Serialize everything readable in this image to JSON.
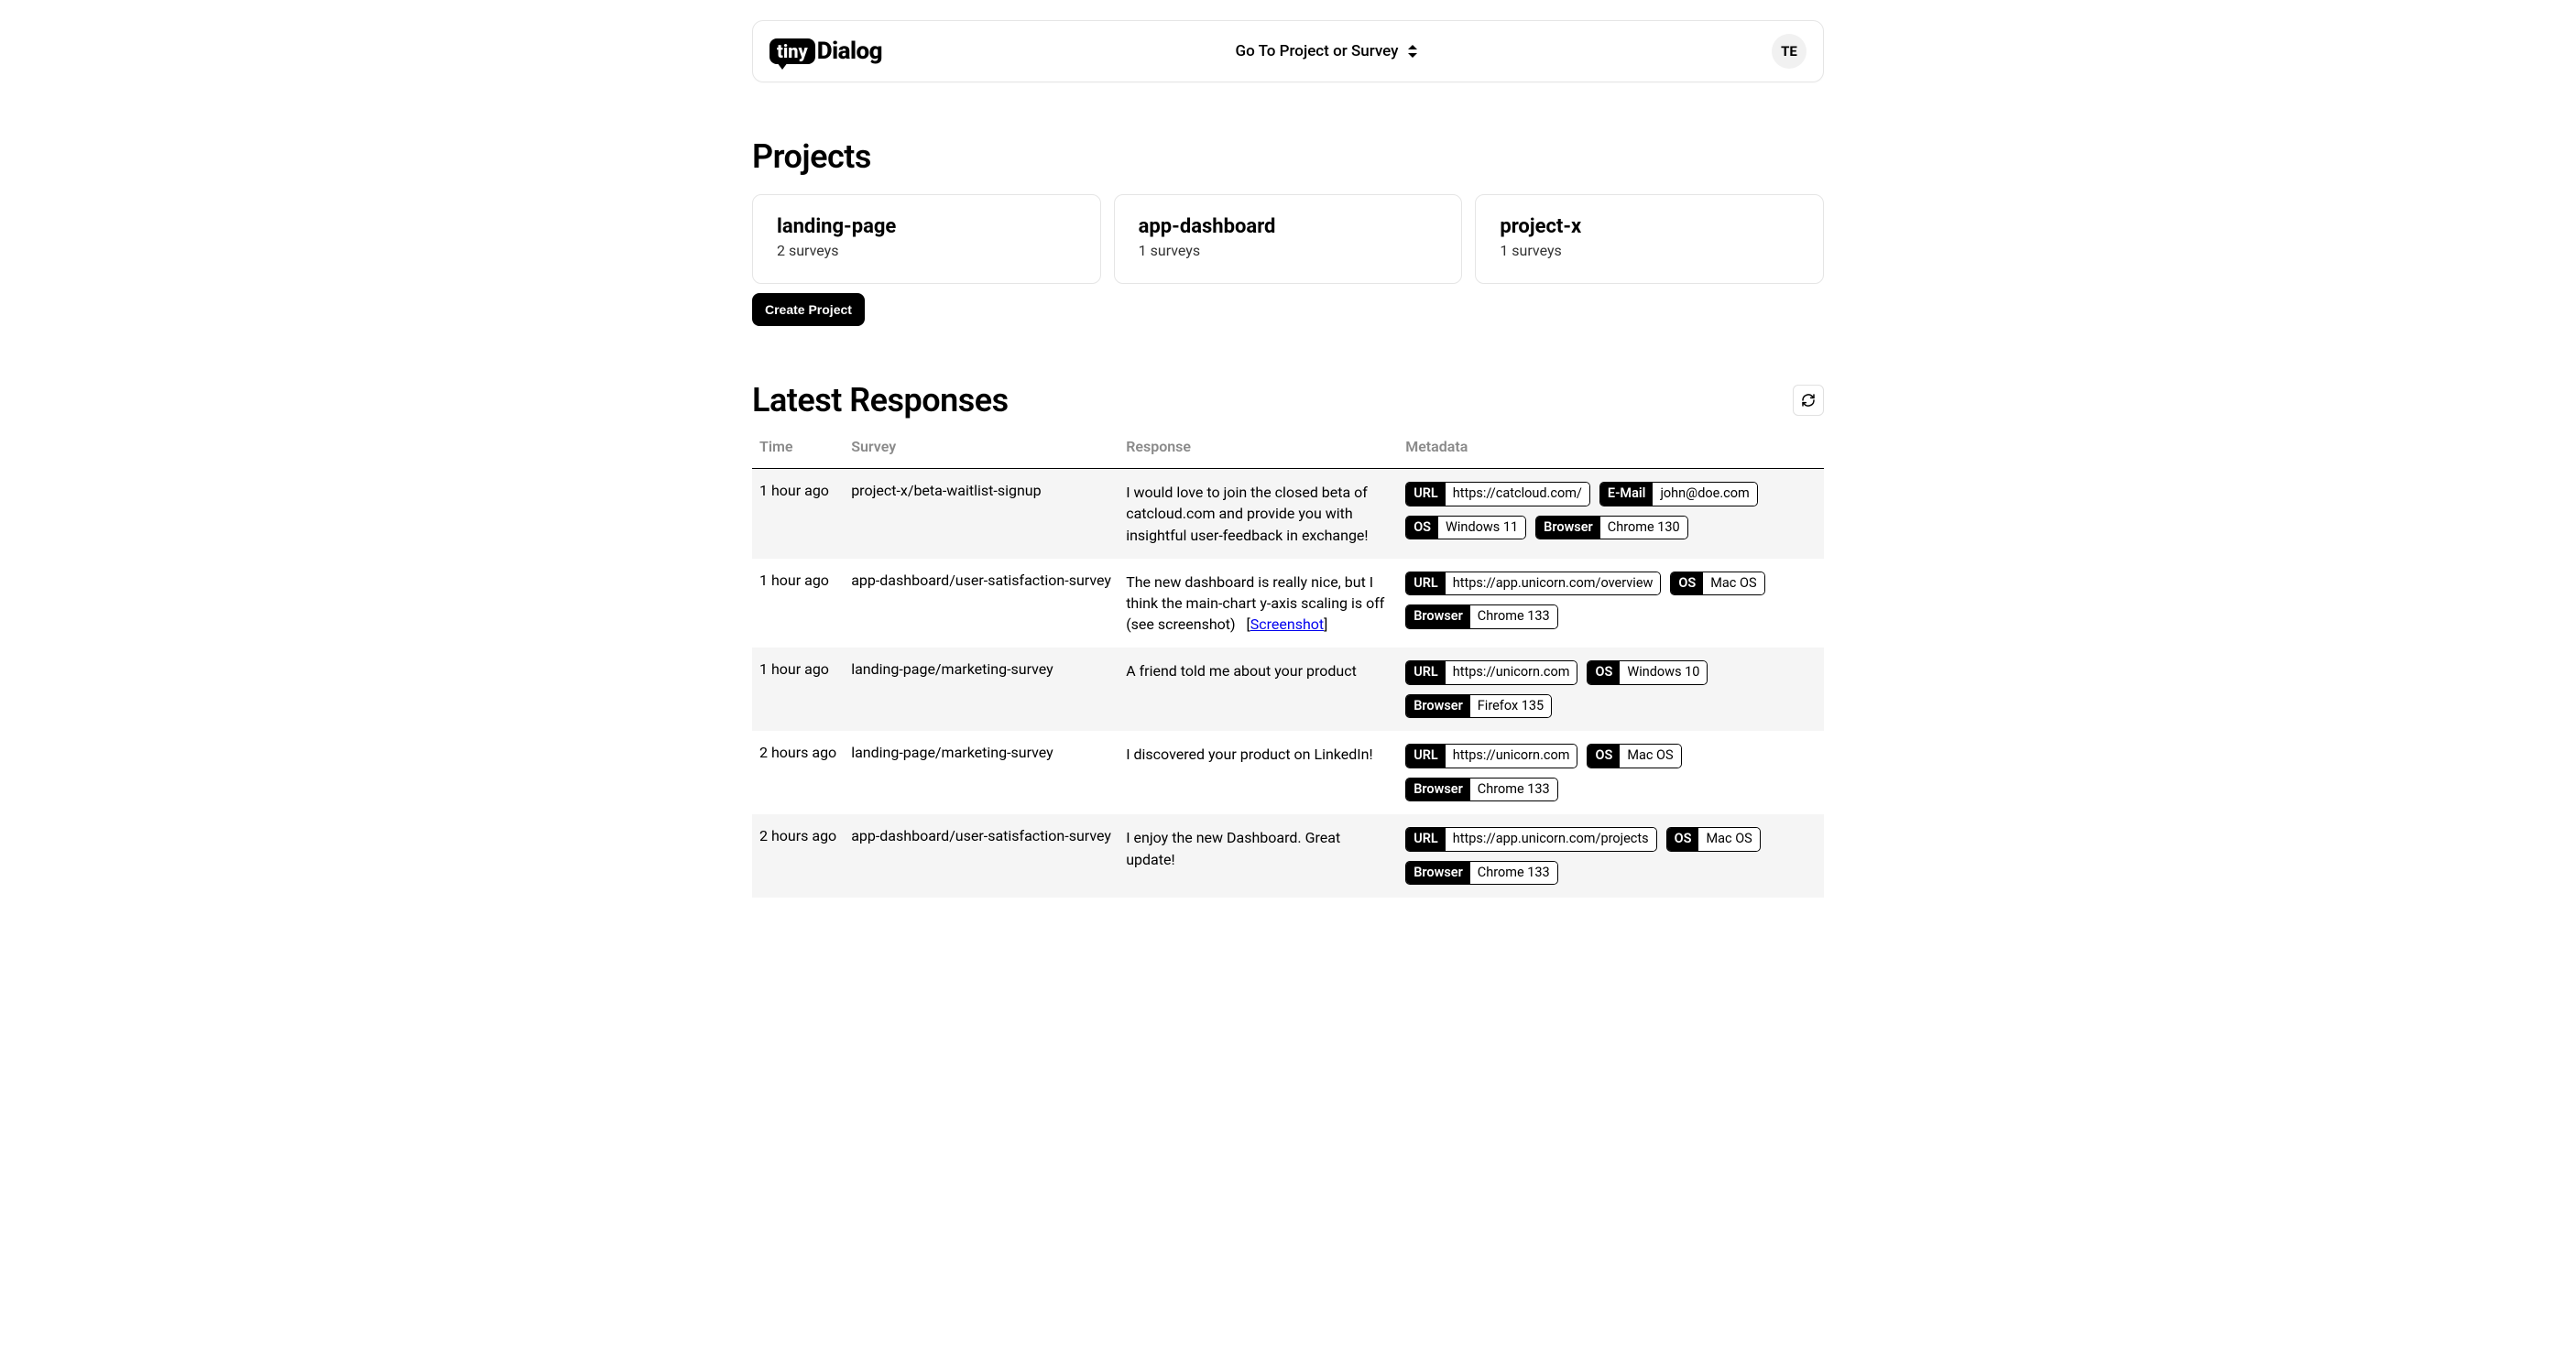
{
  "header": {
    "logo_tiny": "tiny",
    "logo_dialog": "Dialog",
    "nav_label": "Go To Project or Survey",
    "avatar_initials": "TE"
  },
  "projects": {
    "title": "Projects",
    "create_label": "Create Project",
    "items": [
      {
        "name": "landing-page",
        "sub": "2 surveys"
      },
      {
        "name": "app-dashboard",
        "sub": "1 surveys"
      },
      {
        "name": "project-x",
        "sub": "1 surveys"
      }
    ]
  },
  "responses": {
    "title": "Latest Responses",
    "columns": {
      "time": "Time",
      "survey": "Survey",
      "response": "Response",
      "metadata": "Metadata"
    },
    "screenshot_label": "Screenshot",
    "rows": [
      {
        "time": "1 hour ago",
        "survey": "project-x/beta-waitlist-signup",
        "response": "I would love to join the closed beta of catcloud.com and provide you with insightful user-feedback in exchange!",
        "has_screenshot": false,
        "meta": [
          {
            "k": "URL",
            "v": "https://catcloud.com/"
          },
          {
            "k": "E-Mail",
            "v": "john@doe.com"
          },
          {
            "k": "OS",
            "v": "Windows 11"
          },
          {
            "k": "Browser",
            "v": "Chrome 130"
          }
        ]
      },
      {
        "time": "1 hour ago",
        "survey": "app-dashboard/user-satisfaction-survey",
        "response": "The new dashboard is really nice, but I think the main-chart y-axis scaling is off (see screenshot)",
        "has_screenshot": true,
        "meta": [
          {
            "k": "URL",
            "v": "https://app.unicorn.com/overview"
          },
          {
            "k": "OS",
            "v": "Mac OS"
          },
          {
            "k": "Browser",
            "v": "Chrome 133"
          }
        ]
      },
      {
        "time": "1 hour ago",
        "survey": "landing-page/marketing-survey",
        "response": "A friend told me about your product",
        "has_screenshot": false,
        "meta": [
          {
            "k": "URL",
            "v": "https://unicorn.com"
          },
          {
            "k": "OS",
            "v": "Windows 10"
          },
          {
            "k": "Browser",
            "v": "Firefox 135"
          }
        ]
      },
      {
        "time": "2 hours ago",
        "survey": "landing-page/marketing-survey",
        "response": "I discovered your product on LinkedIn!",
        "has_screenshot": false,
        "meta": [
          {
            "k": "URL",
            "v": "https://unicorn.com"
          },
          {
            "k": "OS",
            "v": "Mac OS"
          },
          {
            "k": "Browser",
            "v": "Chrome 133"
          }
        ]
      },
      {
        "time": "2 hours ago",
        "survey": "app-dashboard/user-satisfaction-survey",
        "response": "I enjoy the new Dashboard. Great update!",
        "has_screenshot": false,
        "meta": [
          {
            "k": "URL",
            "v": "https://app.unicorn.com/projects"
          },
          {
            "k": "OS",
            "v": "Mac OS"
          },
          {
            "k": "Browser",
            "v": "Chrome 133"
          }
        ]
      }
    ]
  }
}
